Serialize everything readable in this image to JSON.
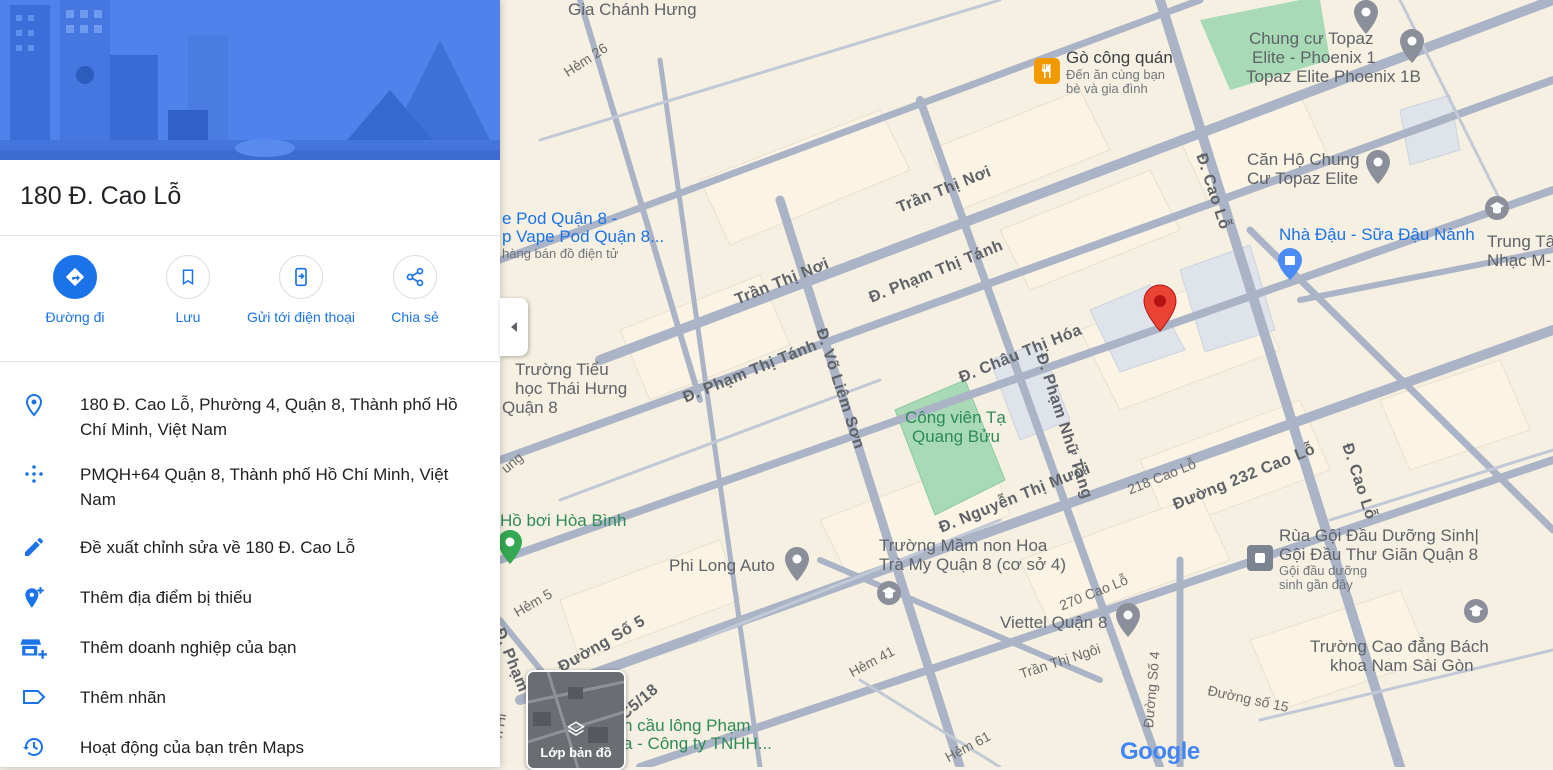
{
  "place": {
    "title": "180 Đ. Cao Lỗ",
    "actions": [
      {
        "label": "Đường đi",
        "icon": "directions-icon"
      },
      {
        "label": "Lưu",
        "icon": "bookmark-icon"
      },
      {
        "label": "Gửi tới điện thoại",
        "icon": "send-to-phone-icon"
      },
      {
        "label": "Chia sẻ",
        "icon": "share-icon"
      }
    ],
    "info": [
      {
        "text": "180 Đ. Cao Lỗ, Phường 4, Quận 8, Thành phố Hồ Chí Minh, Việt Nam",
        "icon": "location-pin-icon"
      },
      {
        "text": "PMQH+64 Quận 8, Thành phố Hồ Chí Minh, Việt Nam",
        "icon": "plus-code-icon"
      },
      {
        "text": "Đề xuất chỉnh sửa về 180 Đ. Cao Lỗ",
        "icon": "pencil-icon"
      },
      {
        "text": "Thêm địa điểm bị thiếu",
        "icon": "add-place-icon"
      },
      {
        "text": "Thêm doanh nghiệp của bạn",
        "icon": "add-business-icon"
      },
      {
        "text": "Thêm nhãn",
        "icon": "label-icon"
      },
      {
        "text": "Hoạt động của bạn trên Maps",
        "icon": "history-icon"
      }
    ]
  },
  "map": {
    "layers_label": "Lớp bản đồ",
    "logo": "Google",
    "pois": {
      "go_cong_quan": {
        "name": "Gò công quán",
        "sub1": "Đến ăn cùng bạn",
        "sub2": "bè và gia đình"
      },
      "topaz_1": {
        "line1": "Chung cư Topaz",
        "line2": "Elite - Phoenix 1",
        "line3": "Topaz Elite Phoenix 1B"
      },
      "topaz_2": {
        "line1": "Căn Hộ Chung",
        "line2": "Cư Topaz Elite"
      },
      "nha_dau": "Nhà Đậu - Sữa Đậu Nành",
      "trung_tam": {
        "line1": "Trung Tâ",
        "line2": "Nhạc M-"
      },
      "vape": {
        "line1": "e Pod Quận 8 -",
        "line2": "p Vape Pod Quận 8...",
        "line3": "hàng bán đồ điện tử"
      },
      "truong_tieu_hoc": {
        "line1": "Trường Tiểu",
        "line2": "học Thái Hưng",
        "line3": "Quận 8"
      },
      "cong_vien": {
        "line1": "Công viên Tạ",
        "line2": "Quang Bửu"
      },
      "ho_boi": "Hồ bơi Hòa Bình",
      "phi_long": "Phi Long Auto",
      "mam_non": {
        "line1": "Trường Mầm non Hoa",
        "line2": "Trà My Quận 8 (cơ sở 4)"
      },
      "rua_goi": {
        "line1": "Rùa Gội Đầu Dưỡng Sinh|",
        "line2": "Gội Đầu Thư Giãn Quận 8",
        "sub1": "Gội đầu dưỡng",
        "sub2": "sinh gần đây"
      },
      "viettel": {
        "line1": "270 Cao Lỗ",
        "line2": "Viettel Quận 8"
      },
      "cao_dang": {
        "line1": "Trường Cao đẳng Bách",
        "line2": "khoa Nam Sài Gòn"
      },
      "cau_long": {
        "line1": "n cầu lông Phạm",
        "line2": "a - Công ty TNHH..."
      },
      "gia_chanh_hung": "Gia Chánh Hưng"
    },
    "streets": {
      "hem26": "Hẻm 26",
      "tran_thi_noi_1": "Trần Thị Nơi",
      "tran_thi_noi_2": "Trần Thị Nơi",
      "pham_thi_tanh_1": "Đ. Phạm Thị Tánh",
      "pham_thi_tanh_2": "Đ. Phạm Thị Tánh",
      "vo_liem_son": "Đ. Võ Liêm Sơn",
      "chau_thi_hoa": "Đ. Châu Thị Hóa",
      "pham_nhu_tang": "Đ. Phạm Nhữ Tăng",
      "nguyen_thi_muoi": "Đ. Nguyễn Thị Mười",
      "cao_lo_1": "Đ. Cao Lỗ",
      "cao_lo_2": "Đ. Cao Lỗ",
      "cao_lo_218": "218 Cao Lỗ",
      "duong_232": "Đường 232 Cao Lỗ",
      "tran_thi_ngoi": "Trần Thị Ngôi",
      "duong_so_15": "Đường số 15",
      "duong_so_4": "Đường Số 4",
      "hem5": "Hẻm 5",
      "duong_so_5": "Đường Số 5",
      "c5_18": "C5/18",
      "hem41": "Hẻm 41",
      "hem61": "Hẻm 61",
      "pham": "Đ. Phạm",
      "hien": "n Hi",
      "ung": "ung"
    },
    "colors": {
      "road": "#aab4c6",
      "block": "#fbf3e2",
      "park": "#a8dab5",
      "pin": "#ea4335",
      "accent": "#1a73e8"
    }
  }
}
